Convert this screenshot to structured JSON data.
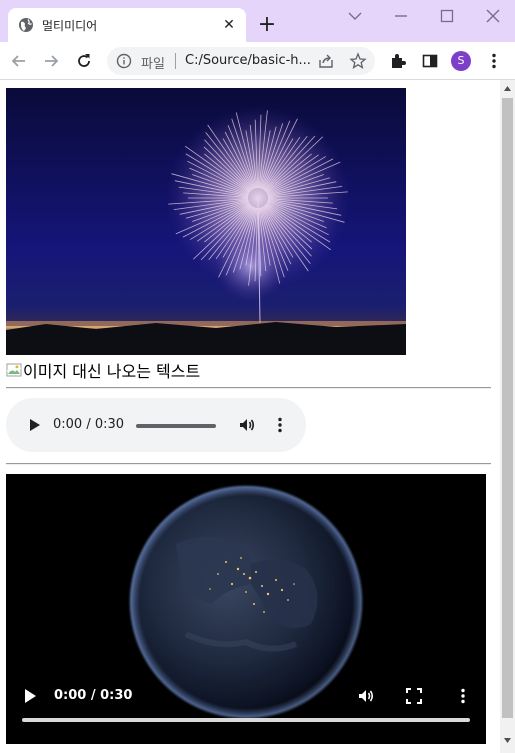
{
  "browser": {
    "tab_title": "멀티미디어",
    "omnibox": {
      "scheme_label": "파일",
      "url": "C:/Source/basic-h..."
    },
    "profile_initial": "S",
    "accent": "#e6d5fa",
    "profile_color": "#7b3fc9"
  },
  "page": {
    "image": {
      "type": "fireworks photo"
    },
    "broken_image": {
      "alt_text": "이미지 대신 나오는 텍스트"
    },
    "audio": {
      "current_time": "0:00",
      "duration": "0:30",
      "time_label": "0:00 / 0:30"
    },
    "video": {
      "subject": "earth at night",
      "time_label": "0:00 / 0:30"
    }
  }
}
